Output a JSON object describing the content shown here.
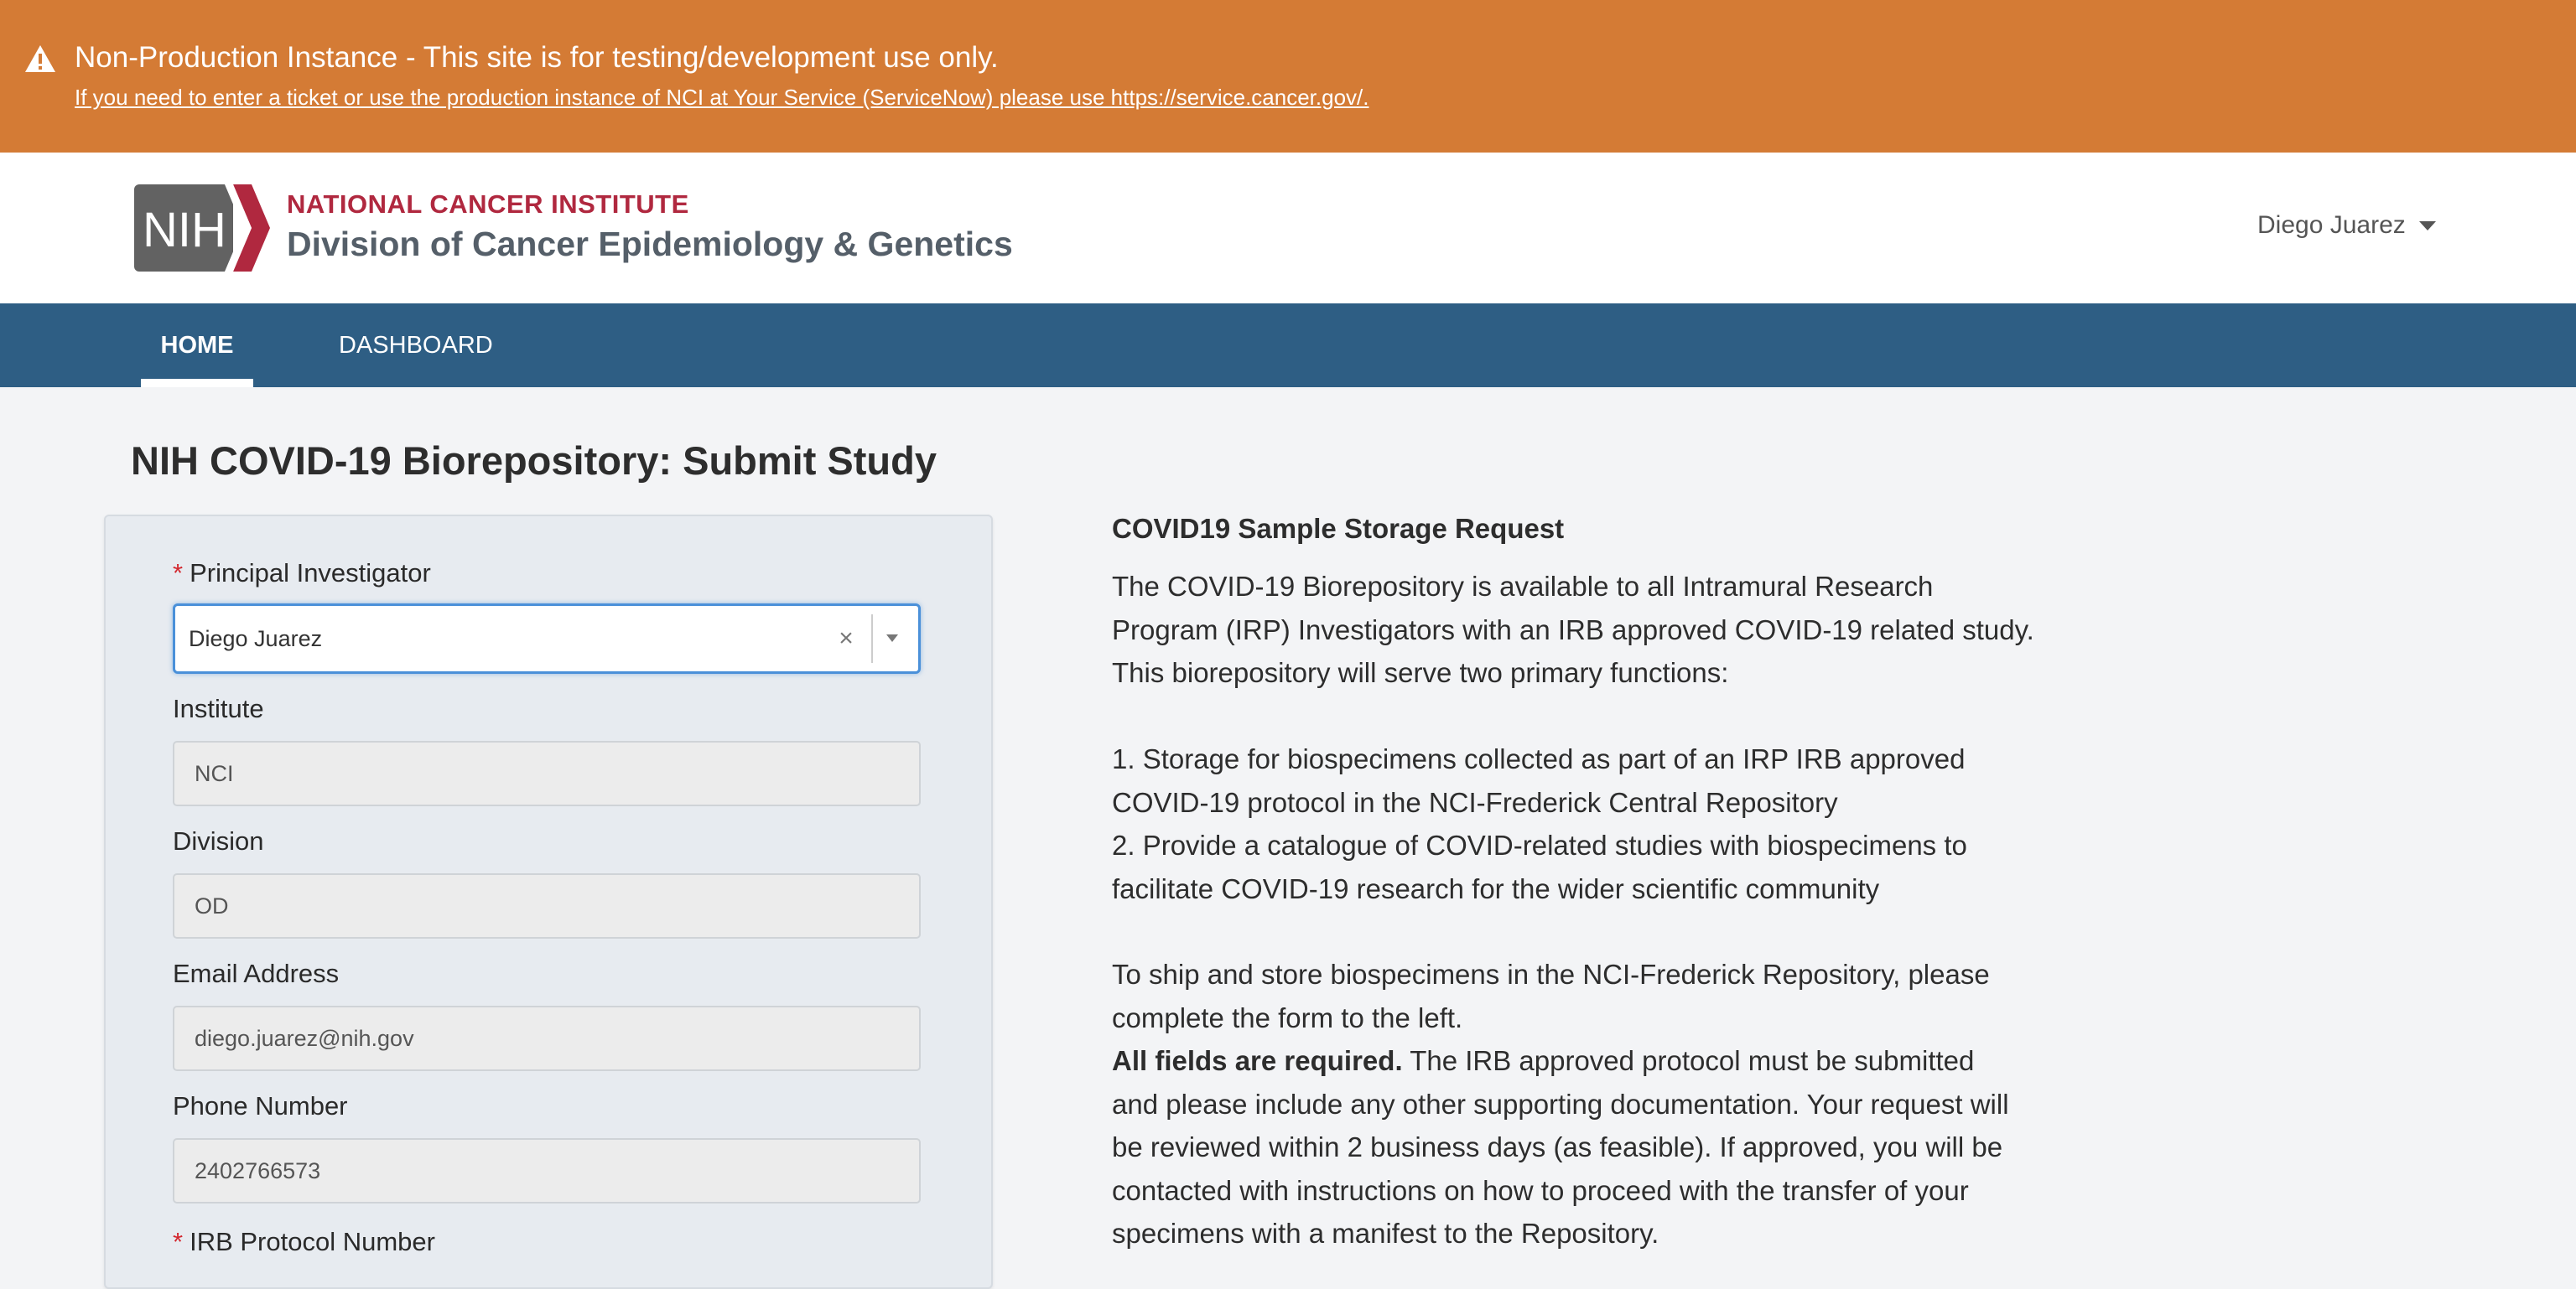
{
  "banner": {
    "icon": "warning-icon",
    "title": "Non-Production Instance - This site is for testing/development use only.",
    "link_text": "If you need to enter a ticket or use the production instance of NCI at Your Service (ServiceNow) please use https://service.cancer.gov/."
  },
  "header": {
    "logo_text": "NIH",
    "org_name": "NATIONAL CANCER INSTITUTE",
    "division_name": "Division of Cancer Epidemiology & Genetics",
    "user_name": "Diego Juarez"
  },
  "nav": {
    "items": [
      {
        "label": "HOME",
        "active": true
      },
      {
        "label": "DASHBOARD",
        "active": false
      }
    ]
  },
  "page": {
    "title": "NIH COVID-19 Biorepository: Submit Study"
  },
  "form": {
    "required_mark": "*",
    "principal_investigator": {
      "label": "Principal Investigator",
      "value": "Diego Juarez",
      "clear_glyph": "×"
    },
    "institute": {
      "label": "Institute",
      "value": "NCI"
    },
    "division": {
      "label": "Division",
      "value": "OD"
    },
    "email": {
      "label": "Email Address",
      "value": "diego.juarez@nih.gov"
    },
    "phone": {
      "label": "Phone Number",
      "value": "2402766573"
    },
    "irb": {
      "label": "IRB Protocol Number"
    }
  },
  "info": {
    "title": "COVID19 Sample Storage Request",
    "p1": [
      "The COVID-19 Biorepository is available to all Intramural Research",
      "Program (IRP) Investigators with an IRB approved COVID-19 related study.",
      "This biorepository will serve two primary functions:"
    ],
    "p2": [
      "1. Storage for biospecimens collected as part of an IRP IRB approved",
      "COVID-19 protocol in the NCI-Frederick Central Repository",
      "2. Provide a catalogue of COVID-related studies with biospecimens to",
      "facilitate COVID-19 research for the wider scientific community"
    ],
    "p3": [
      "To ship and store biospecimens in the NCI-Frederick Repository, please",
      "complete the form to the left."
    ],
    "p4_bold": "All fields are required.",
    "p4_first_rest": " The IRB approved protocol must be submitted",
    "p4": [
      "and please include any other supporting documentation. Your request will",
      "be reviewed within 2 business days (as feasible). If approved, you will be",
      "contacted with instructions on how to proceed with the transfer of your",
      "specimens with a manifest to the Repository."
    ]
  },
  "colors": {
    "banner": "#d47b35",
    "nav": "#2e5e84",
    "brand_red": "#b0283f",
    "required": "#d3272e",
    "focus": "#4a90d9"
  }
}
